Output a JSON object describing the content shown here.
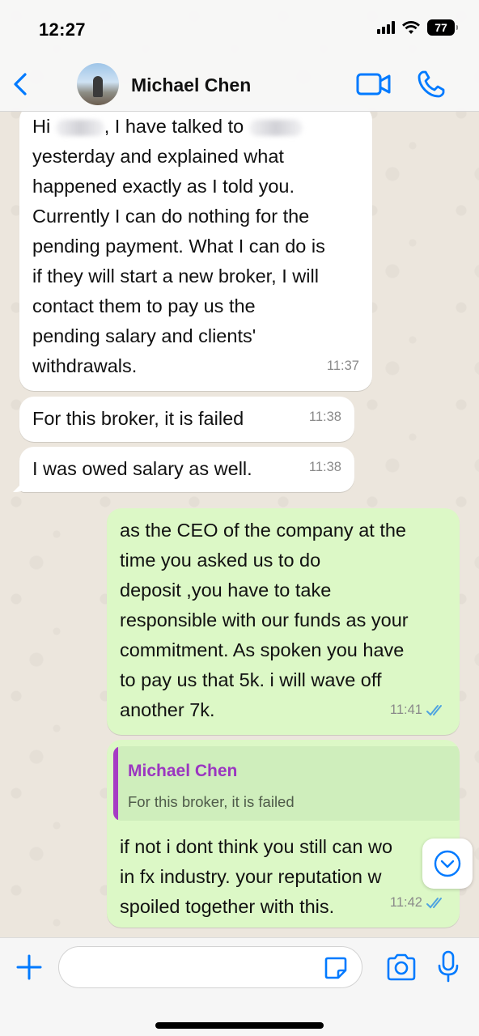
{
  "status_bar": {
    "time": "12:27",
    "battery": "77"
  },
  "header": {
    "contact_name": "Michael Chen"
  },
  "messages": [
    {
      "direction": "in",
      "text_prefix": "Hi",
      "text_mid": "I have talked to",
      "text": "yesterday and explained what\nhappened exactly as I told you.\nCurrently I can do nothing for the\npending payment. What I can do is\nif they will start a new broker, I will\ncontact them to pay us the\npending salary and clients'\nwithdrawals.",
      "time": "11:37"
    },
    {
      "direction": "in",
      "text": "For this broker, it is failed",
      "time": "11:38"
    },
    {
      "direction": "in",
      "text": "I was owed salary as well.",
      "time": "11:38"
    },
    {
      "direction": "out",
      "text": "as the CEO of the company at the\ntime you asked us to do\ndeposit ,you have to take\nresponsible with our funds as your\ncommitment. As spoken you have\nto pay us that 5k. i will wave off\nanother 7k.",
      "time": "11:41"
    },
    {
      "direction": "out",
      "reply_to": {
        "name": "Michael Chen",
        "text": "For this broker, it is failed"
      },
      "text": "if not i dont think you still can wo\nin fx industry. your reputation w\nspoiled together with this.",
      "time": "11:42"
    }
  ],
  "input": {
    "value": ""
  },
  "colors": {
    "accent": "#007aff",
    "outgoing": "#dcf8c6",
    "incoming": "#ffffff",
    "quote_name": "#9b36c1",
    "read_ticks": "#4fa3e0"
  }
}
